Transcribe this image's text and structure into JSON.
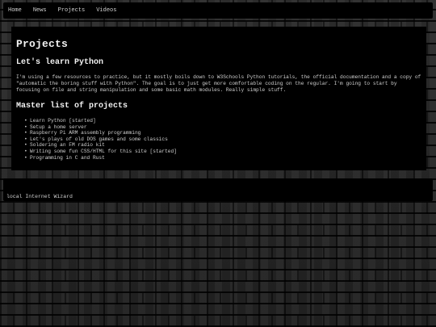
{
  "nav": {
    "items": [
      {
        "label": "Home"
      },
      {
        "label": "News"
      },
      {
        "label": "Projects"
      },
      {
        "label": "Videos"
      }
    ]
  },
  "main": {
    "title": "Projects",
    "section1": {
      "heading": "Let's learn Python",
      "paragraph": "I'm using a few resources to practice, but it mostly boils down to W3Schools Python tutorials, the official documentation and a copy of \"automatic the boring stuff with Python\". The goal is to just get more comfortable coding on the regular. I'm going to start by focusing on file and string manipulation and some basic math modules. Really simple stuff."
    },
    "section2": {
      "heading": "Master list of projects",
      "items": [
        "Learn Python [started]",
        "Setup a home server",
        "Raspberry Pi ARM assembly programming",
        "Let's plays of old DOS games and some classics",
        "Soldering an FM radio kit",
        "Writing some fun CSS/HTML for this site [started]",
        "Programming in C and Rust"
      ]
    }
  },
  "footer": {
    "text": "local Internet Wizard"
  },
  "colors": {
    "panel": "#000000",
    "text": "#cfcfcf",
    "heading": "#f2f2f2",
    "wall": "#262626"
  }
}
